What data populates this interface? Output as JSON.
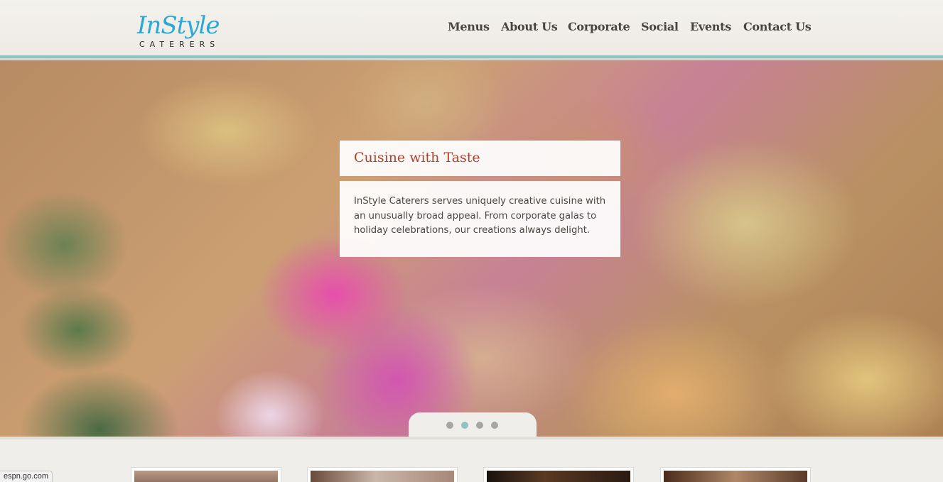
{
  "brand": {
    "logo_script": "InStyle",
    "logo_sub": "CATERERS"
  },
  "nav": {
    "items": [
      {
        "label": "Menus"
      },
      {
        "label": "About Us"
      },
      {
        "label": "Corporate"
      },
      {
        "label": "Social"
      },
      {
        "label": "Events"
      },
      {
        "label": "Contact Us"
      }
    ]
  },
  "hero": {
    "caption_title": "Cuisine with Taste",
    "caption_body": "InStyle Caterers serves uniquely creative cuisine with an unusually broad appeal. From corporate galas to holiday celebrations, our creations always delight.",
    "slides_total": 4,
    "active_slide": 2
  },
  "status_bar": {
    "url": "espn.go.com"
  },
  "colors": {
    "accent_teal": "#8ec5c3",
    "logo_blue": "#2aa8d6",
    "caption_red": "#b0412c",
    "nav_text": "#4a4440"
  },
  "icons": [
    "pager-dot-icon"
  ]
}
